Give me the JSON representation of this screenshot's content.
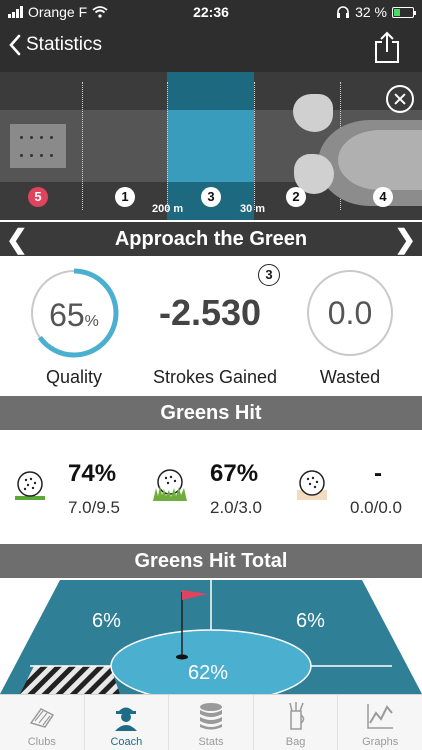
{
  "status_bar": {
    "carrier": "Orange F",
    "time": "22:36",
    "battery": "32 %"
  },
  "nav": {
    "back_label": "Statistics"
  },
  "hole_diagram": {
    "markers": [
      "5",
      "1",
      "3",
      "2",
      "4"
    ],
    "distances": [
      "200 m",
      "30 m"
    ]
  },
  "approach": {
    "title": "Approach the Green",
    "quality_value": "65",
    "quality_unit": "%",
    "quality_fraction": 0.65,
    "quality_label": "Quality",
    "strokes_gained_value": "-2.530",
    "strokes_gained_label": "Strokes Gained",
    "badge": "3",
    "wasted_value": "0.0",
    "wasted_label": "Wasted"
  },
  "greens_hit": {
    "title": "Greens Hit",
    "items": [
      {
        "icon": "golf-ball-fairway-icon",
        "pct": "74%",
        "fraction": "7.0/9.5"
      },
      {
        "icon": "golf-ball-rough-icon",
        "pct": "67%",
        "fraction": "2.0/3.0"
      },
      {
        "icon": "golf-ball-sand-icon",
        "pct": "-",
        "fraction": "0.0/0.0"
      }
    ]
  },
  "greens_hit_total": {
    "title": "Greens Hit Total",
    "left_pct": "6%",
    "right_pct": "6%",
    "center_pct": "62%"
  },
  "tabs": [
    {
      "label": "Clubs",
      "icon": "clubs-icon",
      "active": false
    },
    {
      "label": "Coach",
      "icon": "coach-icon",
      "active": true
    },
    {
      "label": "Stats",
      "icon": "stats-icon",
      "active": false
    },
    {
      "label": "Bag",
      "icon": "bag-icon",
      "active": false
    },
    {
      "label": "Graphs",
      "icon": "graphs-icon",
      "active": false
    }
  ],
  "colors": {
    "accent": "#4bafd0",
    "dark_header": "#3a3a3a",
    "green_blue": "#2f7f96",
    "marker_red": "#e0435e"
  }
}
